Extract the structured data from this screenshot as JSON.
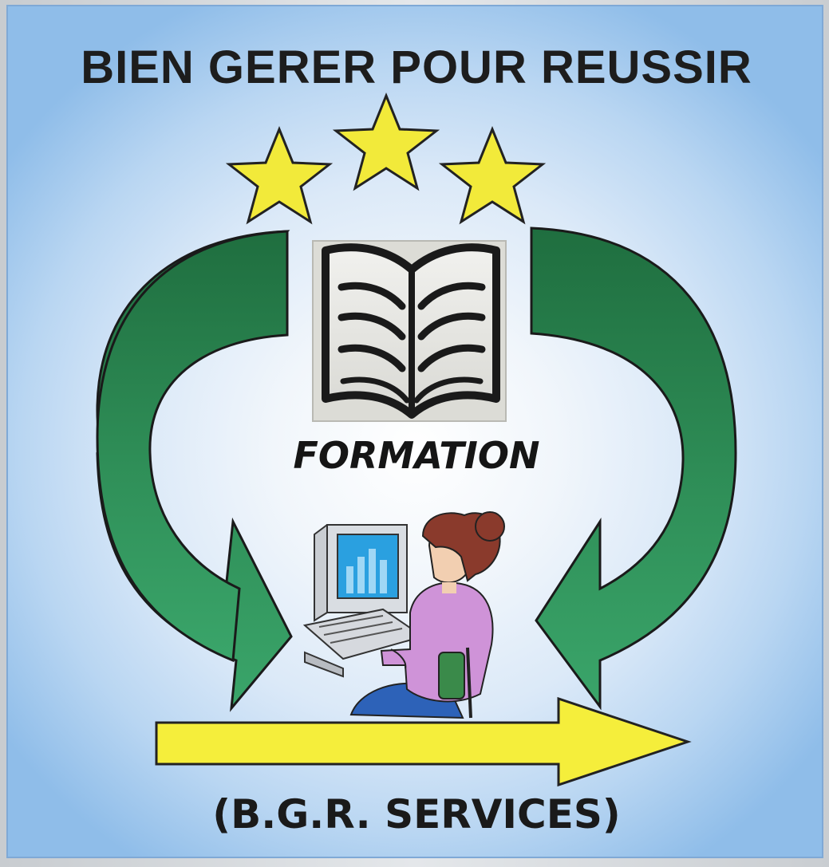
{
  "logo": {
    "headline": "BIEN GERER POUR REUSSIR",
    "caption": "FORMATION",
    "footer": "(B.G.R. SERVICES)",
    "colors": {
      "star": "#f2ea3a",
      "arrow_green": "#2e8b57",
      "arrow_yellow": "#f5ee3b",
      "background": "#b9d6f2"
    },
    "icons": [
      "star-icon",
      "open-book-icon",
      "computer-icon",
      "person-at-desk-icon"
    ]
  }
}
